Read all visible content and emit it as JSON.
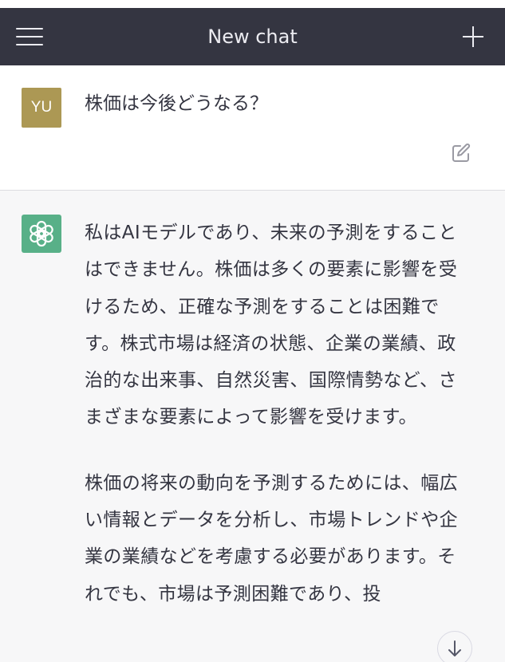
{
  "header": {
    "menu_icon": "hamburger-menu-icon",
    "title": "New chat",
    "new_chat_icon": "plus-icon"
  },
  "user_message": {
    "avatar_initials": "YU",
    "avatar_color": "#ac9854",
    "text": "株価は今後どうなる？",
    "edit_icon": "edit-icon"
  },
  "assistant_message": {
    "avatar_icon": "openai-logo-icon",
    "avatar_color": "#58b088",
    "paragraphs": [
      "私はAIモデルであり、未来の予測をすることはできません。株価は多くの要素に影響を受けるため、正確な予測をすることは困難です。株式市場は経済の状態、企業の業績、政治的な出来事、自然災害、国際情勢など、さまざまな要素によって影響を受けます。",
      "株価の将来の動向を予測するためには、幅広い情報とデータを分析し、市場トレンドや企業の業績などを考慮する必要があります。それでも、市場は予測困難であり、投"
    ]
  },
  "scroll_down_icon": "arrow-down-icon",
  "colors": {
    "header_bg": "#343541",
    "assistant_bg": "#f7f7f8",
    "text": "#343541"
  }
}
